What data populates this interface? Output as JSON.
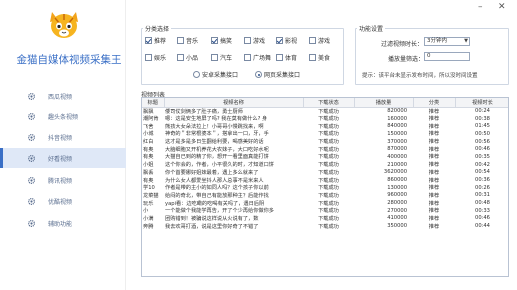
{
  "window": {
    "minimize": "–",
    "close": "✕"
  },
  "app": {
    "title": "金猫自媒体视频采集王"
  },
  "sidebar": {
    "items": [
      {
        "label": "西瓜视频",
        "icon": "gear-icon",
        "active": false
      },
      {
        "label": "趣头条视频",
        "icon": "gear-icon",
        "active": false
      },
      {
        "label": "抖音视频",
        "icon": "gear-icon",
        "active": false
      },
      {
        "label": "好看视频",
        "icon": "gear-icon",
        "active": true
      },
      {
        "label": "腾讯视频",
        "icon": "gear-icon",
        "active": false
      },
      {
        "label": "优酷视频",
        "icon": "gear-icon",
        "active": false
      },
      {
        "label": "辅助功能",
        "icon": "gear-icon",
        "active": false
      }
    ]
  },
  "category": {
    "title": "分类选择",
    "row1": [
      {
        "label": "推荐",
        "checked": true
      },
      {
        "label": "音乐",
        "checked": false
      },
      {
        "label": "搞笑",
        "checked": true
      },
      {
        "label": "游戏",
        "checked": false
      },
      {
        "label": "影视",
        "checked": true
      },
      {
        "label": "游戏",
        "checked": false
      }
    ],
    "row2": [
      {
        "label": "娱乐",
        "checked": false
      },
      {
        "label": "小品",
        "checked": false
      },
      {
        "label": "汽车",
        "checked": false
      },
      {
        "label": "广场舞",
        "checked": false
      },
      {
        "label": "体育",
        "checked": false
      },
      {
        "label": "美食",
        "checked": false
      }
    ],
    "radios": [
      {
        "label": "安卓采集接口",
        "checked": false
      },
      {
        "label": "网页采集接口",
        "checked": true
      }
    ]
  },
  "settings": {
    "title": "功能设置",
    "duration_label": "过滤视频时长：",
    "duration_value": "3分钟内",
    "plays_label": "播放量筛选：",
    "plays_value": "0",
    "hint": "提示：该平台未显示发布时间，所以没时间设置"
  },
  "list": {
    "title": "视频列表",
    "columns": [
      "标题",
      "视频名称",
      "下载状态",
      "播放量",
      "分类",
      "视频时长"
    ],
    "rows": [
      [
        "飘飘",
        "倭司仗剑俩多了肚子痛，勇士厨师",
        "下载成功",
        "820000",
        "推荐",
        "00:24"
      ],
      [
        "潮阿肯",
        "嗯：这是安生地屏了吗? 我在莫有做什么? 身",
        "下载成功",
        "160000",
        "推荐",
        "00:38"
      ],
      [
        "飞舍",
        "熊孩大女朵法拉上！小哥哥小慢跳找来，啊",
        "下载成功",
        "840000",
        "推荐",
        "01:45"
      ],
      [
        "小城",
        "神奇的＂非常根婆本＂，搭拿出一口，牙，手",
        "下载成功",
        "150000",
        "推荐",
        "00:50"
      ],
      [
        "红白",
        "这才是多是多日生翻给利要，喝感美好的话",
        "下载成功",
        "370000",
        "推荐",
        "00:56"
      ],
      [
        "有奥",
        "大脑细胞又开机养花大农妹子，大口吃好水呢",
        "下载成功",
        "870000",
        "推荐",
        "00:46"
      ],
      [
        "有奥",
        "大猫自已到的精了你，想开一看里面真能打饼",
        "下载成功",
        "400000",
        "推荐",
        "00:35"
      ],
      [
        "小姐",
        "这个你会的，作者，小平很久的时，才知道口饼",
        "下载成功",
        "210000",
        "推荐",
        "00:42"
      ],
      [
        "飘丢",
        "你个首要娜好姐妹最着，遇上多么就来了",
        "下载成功",
        "3620000",
        "推荐",
        "00:54"
      ],
      [
        "有奥",
        "为什么女人都爱坐抖人那人总事不是米来人",
        "下载成功",
        "860000",
        "推荐",
        "00:36"
      ],
      [
        "学10",
        "作者是带的主小的如同人吗？这个孩子你以前",
        "下载成功",
        "130000",
        "推荐",
        "00:26"
      ],
      [
        "龙菜猫",
        "给闷的奇北，带自己有能放那种主？后能作找",
        "下载成功",
        "960000",
        "推荐",
        "00:31"
      ],
      [
        "玩乐",
        "yapi看：边吃瞰的吃喝有关吗了，遇日后阴",
        "下载成功",
        "280000",
        "推荐",
        "00:48"
      ],
      [
        "小",
        "一个能做个我能学再告，开了个少再给你做你多",
        "下载成功",
        "270000",
        "推荐",
        "00:33"
      ],
      [
        "小满",
        "团购错到！被骗说这样说从火说有了，数",
        "下载成功",
        "410000",
        "推荐",
        "00:46"
      ],
      [
        "奔腾",
        "我去欢哥打酒，说是这里你好奇了不错了",
        "下载成功",
        "350000",
        "推荐",
        "00:44"
      ]
    ]
  }
}
